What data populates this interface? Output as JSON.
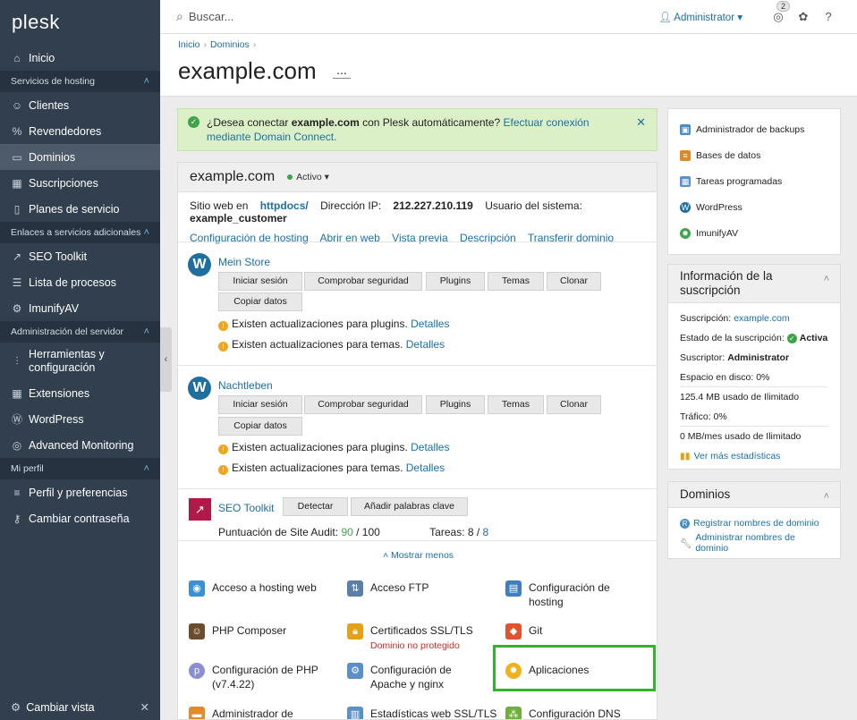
{
  "sidebar": {
    "logo": "plesk",
    "items": [
      {
        "label": "Inicio",
        "icon": "home-icon"
      },
      {
        "section": "Servicios de hosting"
      },
      {
        "label": "Clientes",
        "icon": "user-icon"
      },
      {
        "label": "Revendedores",
        "icon": "percent-icon"
      },
      {
        "label": "Dominios",
        "icon": "monitor-icon",
        "active": true
      },
      {
        "label": "Suscripciones",
        "icon": "grid-icon"
      },
      {
        "label": "Planes de servicio",
        "icon": "book-icon"
      },
      {
        "section": "Enlaces a servicios adicionales"
      },
      {
        "label": "SEO Toolkit",
        "icon": "chart-icon"
      },
      {
        "label": "Lista de procesos",
        "icon": "list-icon"
      },
      {
        "label": "ImunifyAV",
        "icon": "gear-icon"
      },
      {
        "section": "Administración del servidor"
      },
      {
        "label": "Herramientas y configuración",
        "icon": "sliders-icon",
        "tall": true
      },
      {
        "label": "Extensiones",
        "icon": "grid-icon"
      },
      {
        "label": "WordPress",
        "icon": "wordpress-icon"
      },
      {
        "label": "Advanced Monitoring",
        "icon": "monitor-search-icon"
      },
      {
        "section": "Mi perfil"
      },
      {
        "label": "Perfil y preferencias",
        "icon": "profile-icon"
      },
      {
        "label": "Cambiar contraseña",
        "icon": "key-icon"
      }
    ],
    "bottom_label": "Cambiar vista"
  },
  "topbar": {
    "search_placeholder": "Buscar...",
    "user": "Administrator",
    "notifications_count": "2"
  },
  "page": {
    "breadcrumb": [
      "Inicio",
      "Dominios"
    ],
    "title": "example.com",
    "more": "..."
  },
  "notice": {
    "text_before": "¿Desea conectar ",
    "domain": "example.com",
    "text_after": " con Plesk automáticamente? ",
    "link": "Efectuar conexión mediante Domain Connect."
  },
  "domain_panel": {
    "name": "example.com",
    "status": "Activo",
    "site_label": "Sitio web en ",
    "site_value": "httpdocs/",
    "ip_label": "Dirección IP: ",
    "ip_value": "212.227.210.119",
    "user_label": "Usuario del sistema: ",
    "user_value": "example_customer",
    "links": [
      "Configuración de hosting",
      "Abrir en web",
      "Vista previa",
      "Descripción",
      "Transferir dominio"
    ]
  },
  "apps": [
    {
      "name": "Mein Store",
      "buttons": [
        "Iniciar sesión",
        "Comprobar seguridad",
        "Plugins",
        "Temas",
        "Clonar",
        "Copiar datos"
      ],
      "warnings": [
        {
          "text": "Existen actualizaciones para plugins. ",
          "link": "Detalles"
        },
        {
          "text": "Existen actualizaciones para temas. ",
          "link": "Detalles"
        }
      ]
    },
    {
      "name": "Nachtleben",
      "buttons": [
        "Iniciar sesión",
        "Comprobar seguridad",
        "Plugins",
        "Temas",
        "Clonar",
        "Copiar datos"
      ],
      "warnings": [
        {
          "text": "Existen actualizaciones para plugins. ",
          "link": "Detalles"
        },
        {
          "text": "Existen actualizaciones para temas. ",
          "link": "Detalles"
        }
      ]
    }
  ],
  "seo": {
    "name": "SEO Toolkit",
    "detect": "Detectar",
    "keywords": "Añadir palabras clave",
    "score_label": "Puntuación de Site Audit: ",
    "score": "90",
    "score_total": " / 100",
    "tasks_label": "Tareas: 8 / ",
    "tasks_link": "8"
  },
  "show_less": "Mostrar menos",
  "tools": [
    {
      "label": "Acceso a hosting web",
      "icon": "globe-icon"
    },
    {
      "label": "Acceso FTP",
      "icon": "ftp-icon"
    },
    {
      "label": "Configuración de hosting",
      "icon": "hosting-icon"
    },
    {
      "label": "PHP Composer",
      "icon": "composer-icon"
    },
    {
      "label": "Certificados SSL/TLS",
      "icon": "lock-icon",
      "sub": "Dominio no protegido"
    },
    {
      "label": "Git",
      "icon": "git-icon"
    },
    {
      "label": "Configuración de PHP (v7.4.22)",
      "icon": "php-icon"
    },
    {
      "label": "Configuración de Apache y nginx",
      "icon": "apache-icon"
    },
    {
      "label": "Aplicaciones",
      "icon": "apps-gear-icon"
    },
    {
      "label": "Administrador de",
      "icon": "folder-icon"
    },
    {
      "label": "Estadísticas web SSL/TLS",
      "icon": "stats-icon"
    },
    {
      "label": "Configuración DNS",
      "icon": "dns-icon"
    }
  ],
  "right_links": [
    {
      "label": "Administrador de backups",
      "icon": "backup-icon"
    },
    {
      "label": "Bases de datos",
      "icon": "database-icon"
    },
    {
      "label": "Tareas programadas",
      "icon": "calendar-icon"
    },
    {
      "label": "WordPress",
      "icon": "wordpress-icon"
    },
    {
      "label": "ImunifyAV",
      "icon": "gear-icon"
    }
  ],
  "subscription": {
    "title": "Información de la suscripción",
    "sub_label": "Suscripción: ",
    "sub_value": "example.com",
    "state_label": "Estado de la suscripción: ",
    "state_value": "Activa",
    "owner_label": "Suscriptor: ",
    "owner_value": "Administrator",
    "disk_label": "Espacio en disco: 0%",
    "disk_value": "125.4 MB usado de Ilimitado",
    "traffic_label": "Tráfico: 0%",
    "traffic_value": "0 MB/mes usado de Ilimitado",
    "more_stats": "Ver más estadísticas"
  },
  "domains_box": {
    "title": "Dominios",
    "register": "Registrar nombres de dominio",
    "manage": "Administrar nombres de dominio"
  },
  "colors": {
    "sidebar": "#313f4e",
    "link": "#1b6fa8",
    "highlight": "#34b22f",
    "notice_bg": "#dcf0c8"
  }
}
